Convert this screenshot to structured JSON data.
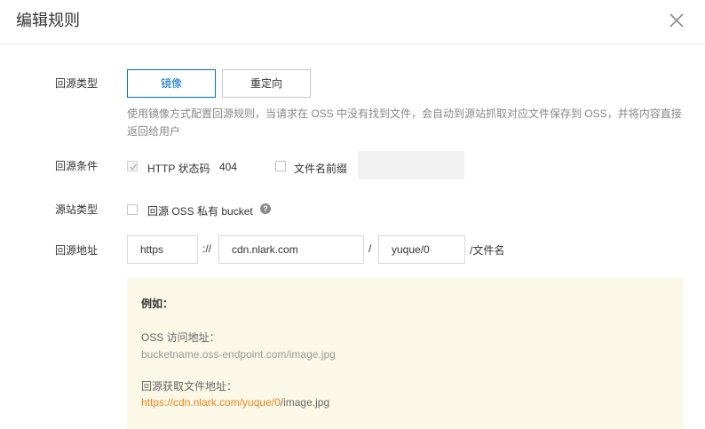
{
  "dialog": {
    "title": "编辑规则",
    "close_icon": "close-icon"
  },
  "source_type": {
    "label": "回源类型",
    "options": [
      "镜像",
      "重定向"
    ],
    "selected": "镜像",
    "description": "使用镜像方式配置回源规则，当请求在 OSS 中没有找到文件，会自动到源站抓取对应文件保存到 OSS，并将内容直接返回给用户",
    "description_line1": "使用镜像方式配置回源规则，当请求在 OSS 中没有找到文件，会自动到源站抓取对应文件保存到 OSS，并将内容直接",
    "description_line2": "返回给用户"
  },
  "condition": {
    "label": "回源条件",
    "http_code_label": "HTTP 状态码",
    "http_code_value": "404",
    "http_code_checked": true,
    "prefix_label": "文件名前缀",
    "prefix_checked": false,
    "prefix_value": ""
  },
  "origin_type": {
    "label": "源站类型",
    "private_bucket_label": "回源 OSS 私有 bucket",
    "private_bucket_checked": false,
    "help_icon": "help-icon"
  },
  "origin_address": {
    "label": "回源地址",
    "protocol": "https",
    "protocol_sep": "://",
    "domain": "cdn.nlark.com",
    "path_sep": "/",
    "path": "yuque/0",
    "suffix": "/文件名"
  },
  "example": {
    "title": "例如：",
    "oss_label": "OSS 访问地址：",
    "oss_url": "bucketname.oss-endpoint.com/image.jpg",
    "origin_label": "回源获取文件地址：",
    "origin_url_prefix": "https://cdn.nlark.com/yuque/0",
    "origin_url_suffix": "/image.jpg"
  },
  "colors": {
    "accent": "#0070cc",
    "example_bg": "#fcf8e8",
    "highlight": "#f08519"
  }
}
